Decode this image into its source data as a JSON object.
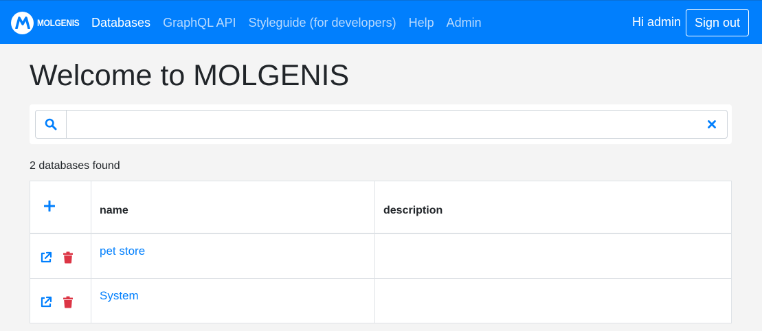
{
  "colors": {
    "navbar": "#017ffd",
    "nav_link_inactive": "#b9dafe",
    "link": "#017ffd",
    "danger": "#dc3545",
    "background": "#f4f4f4"
  },
  "navbar": {
    "brand": "MOLGENIS",
    "brand_icon": "molgenis-logo-icon",
    "links": [
      {
        "label": "Databases",
        "active": true
      },
      {
        "label": "GraphQL API",
        "active": false
      },
      {
        "label": "Styleguide (for developers)",
        "active": false
      },
      {
        "label": "Help",
        "active": false
      },
      {
        "label": "Admin",
        "active": false
      }
    ],
    "greeting": "Hi admin",
    "signout_label": "Sign out"
  },
  "page": {
    "title": "Welcome to MOLGENIS"
  },
  "search": {
    "value": "",
    "placeholder": "",
    "search_icon": "search-icon",
    "clear_icon": "close-icon"
  },
  "results": {
    "count_text": "2 databases found"
  },
  "table": {
    "add_icon": "plus-icon",
    "columns": [
      "name",
      "description"
    ],
    "rows": [
      {
        "name": "pet store",
        "description": ""
      },
      {
        "name": "System",
        "description": ""
      }
    ],
    "row_icons": [
      "external-link-icon",
      "trash-icon"
    ]
  }
}
